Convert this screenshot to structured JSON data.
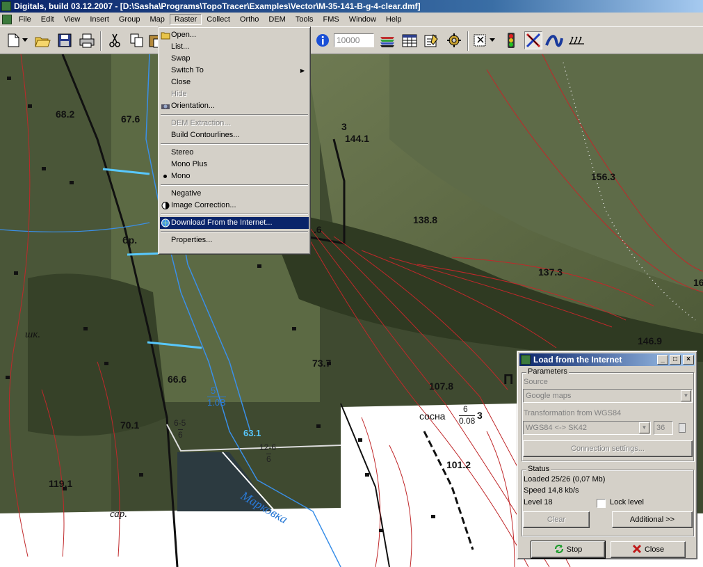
{
  "window": {
    "title": "Digitals, build 03.12.2007 - [D:\\Sasha\\Programs\\TopoTracer\\Examples\\Vector\\M-35-141-B-g-4-clear.dmf]"
  },
  "menubar": [
    "File",
    "Edit",
    "View",
    "Insert",
    "Group",
    "Map",
    "Raster",
    "Collect",
    "Ortho",
    "DEM",
    "Tools",
    "FMS",
    "Window",
    "Help"
  ],
  "toolbar": {
    "zoom_value": "10000"
  },
  "raster_menu": {
    "open": "Open...",
    "list": "List...",
    "swap": "Swap",
    "switch_to": "Switch To",
    "close": "Close",
    "hide": "Hide",
    "orientation": "Orientation...",
    "dem_extraction": "DEM Extraction...",
    "build_contourlines": "Build Contourlines...",
    "stereo": "Stereo",
    "mono_plus": "Mono Plus",
    "mono": "Mono",
    "negative": "Negative",
    "image_correction": "Image Correction...",
    "download": "Download From the Internet...",
    "properties": "Properties..."
  },
  "map_labels": {
    "l1": "68.2",
    "l2": "67.6",
    "l3": "144.1",
    "l4": "3",
    "l5": "156.3",
    "l6": "138.8",
    "l7": ".6",
    "l8": "137.3",
    "l9": "бр.",
    "l10": "16",
    "l11": "146.9",
    "l12": "шк.",
    "l13": "73.7",
    "l14": "66.6",
    "l15": "107.8",
    "l16": "П",
    "l17": "5",
    "l18": "1.0В",
    "l19": "сосна",
    "l20": "6",
    "l21": "0.08",
    "l22": "3",
    "l23": "70.1",
    "l24": "6-5",
    "l25": "6",
    "l26": "63.1",
    "l27": "12-6",
    "l28": "6",
    "l29": "101.2",
    "l30": "119.1",
    "l31": "Марковка",
    "l32": "сар."
  },
  "dialog": {
    "title": "Load from the Internet",
    "parameters_label": "Parameters",
    "source_label": "Source",
    "source_value": "Google maps",
    "transform_label": "Transformation from WGS84",
    "transform_value": "WGS84 <-> SK42",
    "zone_value": "36",
    "connection_button": "Connection settings...",
    "status_label": "Status",
    "loaded": "Loaded 25/26 (0,07 Mb)",
    "speed": "Speed 14,8 kb/s",
    "level": "Level 18",
    "lock_level": "Lock level",
    "clear_button": "Clear",
    "additional_button": "Additional >>",
    "stop_button": "Stop",
    "close_button": "Close"
  },
  "colors": {
    "title_bar": "#0a246a",
    "menu_highlight": "#0a246a",
    "contour": "#c0282a",
    "water": "#2a7ad6"
  }
}
